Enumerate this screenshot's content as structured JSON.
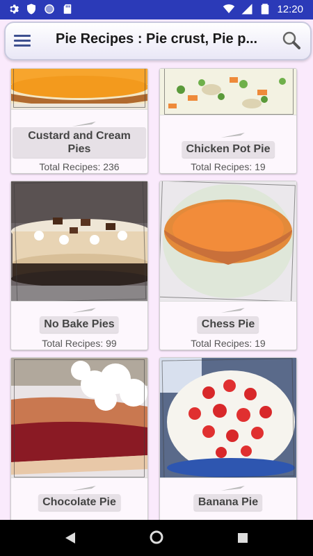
{
  "status_bar": {
    "time": "12:20",
    "icons": [
      "gear-icon",
      "shield-icon",
      "circle-icon",
      "sd-card-icon",
      "wifi-icon",
      "signal-icon",
      "battery-icon"
    ]
  },
  "app_bar": {
    "title": "Pie Recipes : Pie crust, Pie p...",
    "menu_icon": "menu-icon",
    "search_icon": "search-icon"
  },
  "recipes": [
    {
      "label": "Custard and Cream Pies",
      "count": "Total Recipes: 236",
      "image": "custard-pie-photo"
    },
    {
      "label": "Chicken Pot Pie",
      "count": "Total Recipes: 19",
      "image": "chicken-pot-pie-photo"
    },
    {
      "label": "No Bake Pies",
      "count": "Total Recipes: 99",
      "image": "no-bake-pie-photo"
    },
    {
      "label": "Chess Pie",
      "count": "Total Recipes: 19",
      "image": "chess-pie-photo"
    },
    {
      "label": "Chocolate Pie",
      "count": "",
      "image": "chocolate-pie-photo"
    },
    {
      "label": "Banana Pie",
      "count": "",
      "image": "banana-pie-photo"
    }
  ],
  "nav_bar": {
    "buttons": [
      "back-icon",
      "home-icon",
      "recents-icon"
    ]
  },
  "colors": {
    "status_bar": "#2b3ab8",
    "background": "#faeafc",
    "label_bg": "#e6e0e6"
  }
}
